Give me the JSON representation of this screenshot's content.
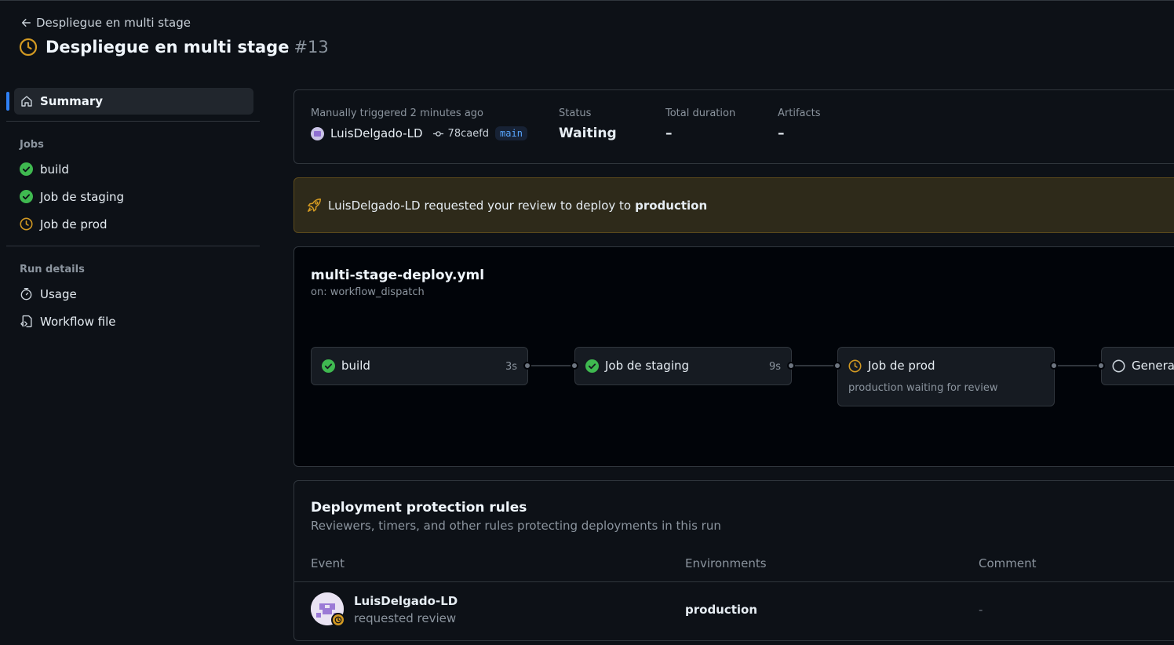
{
  "header": {
    "back_label": "Despliegue en multi stage",
    "title": "Despliegue en multi stage",
    "run_number": "#13"
  },
  "sidebar": {
    "summary_label": "Summary",
    "jobs_heading": "Jobs",
    "jobs": [
      {
        "label": "build",
        "status": "success"
      },
      {
        "label": "Job de staging",
        "status": "success"
      },
      {
        "label": "Job de prod",
        "status": "waiting"
      }
    ],
    "run_details_heading": "Run details",
    "run_details": [
      {
        "label": "Usage",
        "icon": "stopwatch-icon"
      },
      {
        "label": "Workflow file",
        "icon": "file-code-icon"
      }
    ]
  },
  "summary": {
    "trigger_label": "Manually triggered 2 minutes ago",
    "actor": "LuisDelgado-LD",
    "commit": "78caefd",
    "branch": "main",
    "status_label": "Status",
    "status_value": "Waiting",
    "duration_label": "Total duration",
    "duration_value": "–",
    "artifacts_label": "Artifacts",
    "artifacts_value": "–"
  },
  "review_banner": {
    "actor": "LuisDelgado-LD",
    "text": "requested your review to deploy to",
    "environment": "production"
  },
  "workflow": {
    "file_name": "multi-stage-deploy.yml",
    "trigger": "on: workflow_dispatch",
    "jobs": [
      {
        "name": "build",
        "duration": "3s",
        "status": "success",
        "sub": ""
      },
      {
        "name": "Job de staging",
        "duration": "9s",
        "status": "success",
        "sub": ""
      },
      {
        "name": "Job de prod",
        "duration": "",
        "status": "waiting",
        "sub": "production waiting for review"
      },
      {
        "name": "Genera",
        "duration": "",
        "status": "pending",
        "sub": ""
      }
    ]
  },
  "protection_rules": {
    "title": "Deployment protection rules",
    "subtitle": "Reviewers, timers, and other rules protecting deployments in this run",
    "columns": [
      "Event",
      "Environments",
      "Comment"
    ],
    "rows": [
      {
        "actor": "LuisDelgado-LD",
        "event": "requested review",
        "environment": "production",
        "comment": "-"
      }
    ]
  },
  "colors": {
    "background": "#0d1117",
    "success": "#3fb950",
    "waiting": "#d29922",
    "accent": "#2f81f7",
    "banner_bg": "#2e2a1a"
  }
}
